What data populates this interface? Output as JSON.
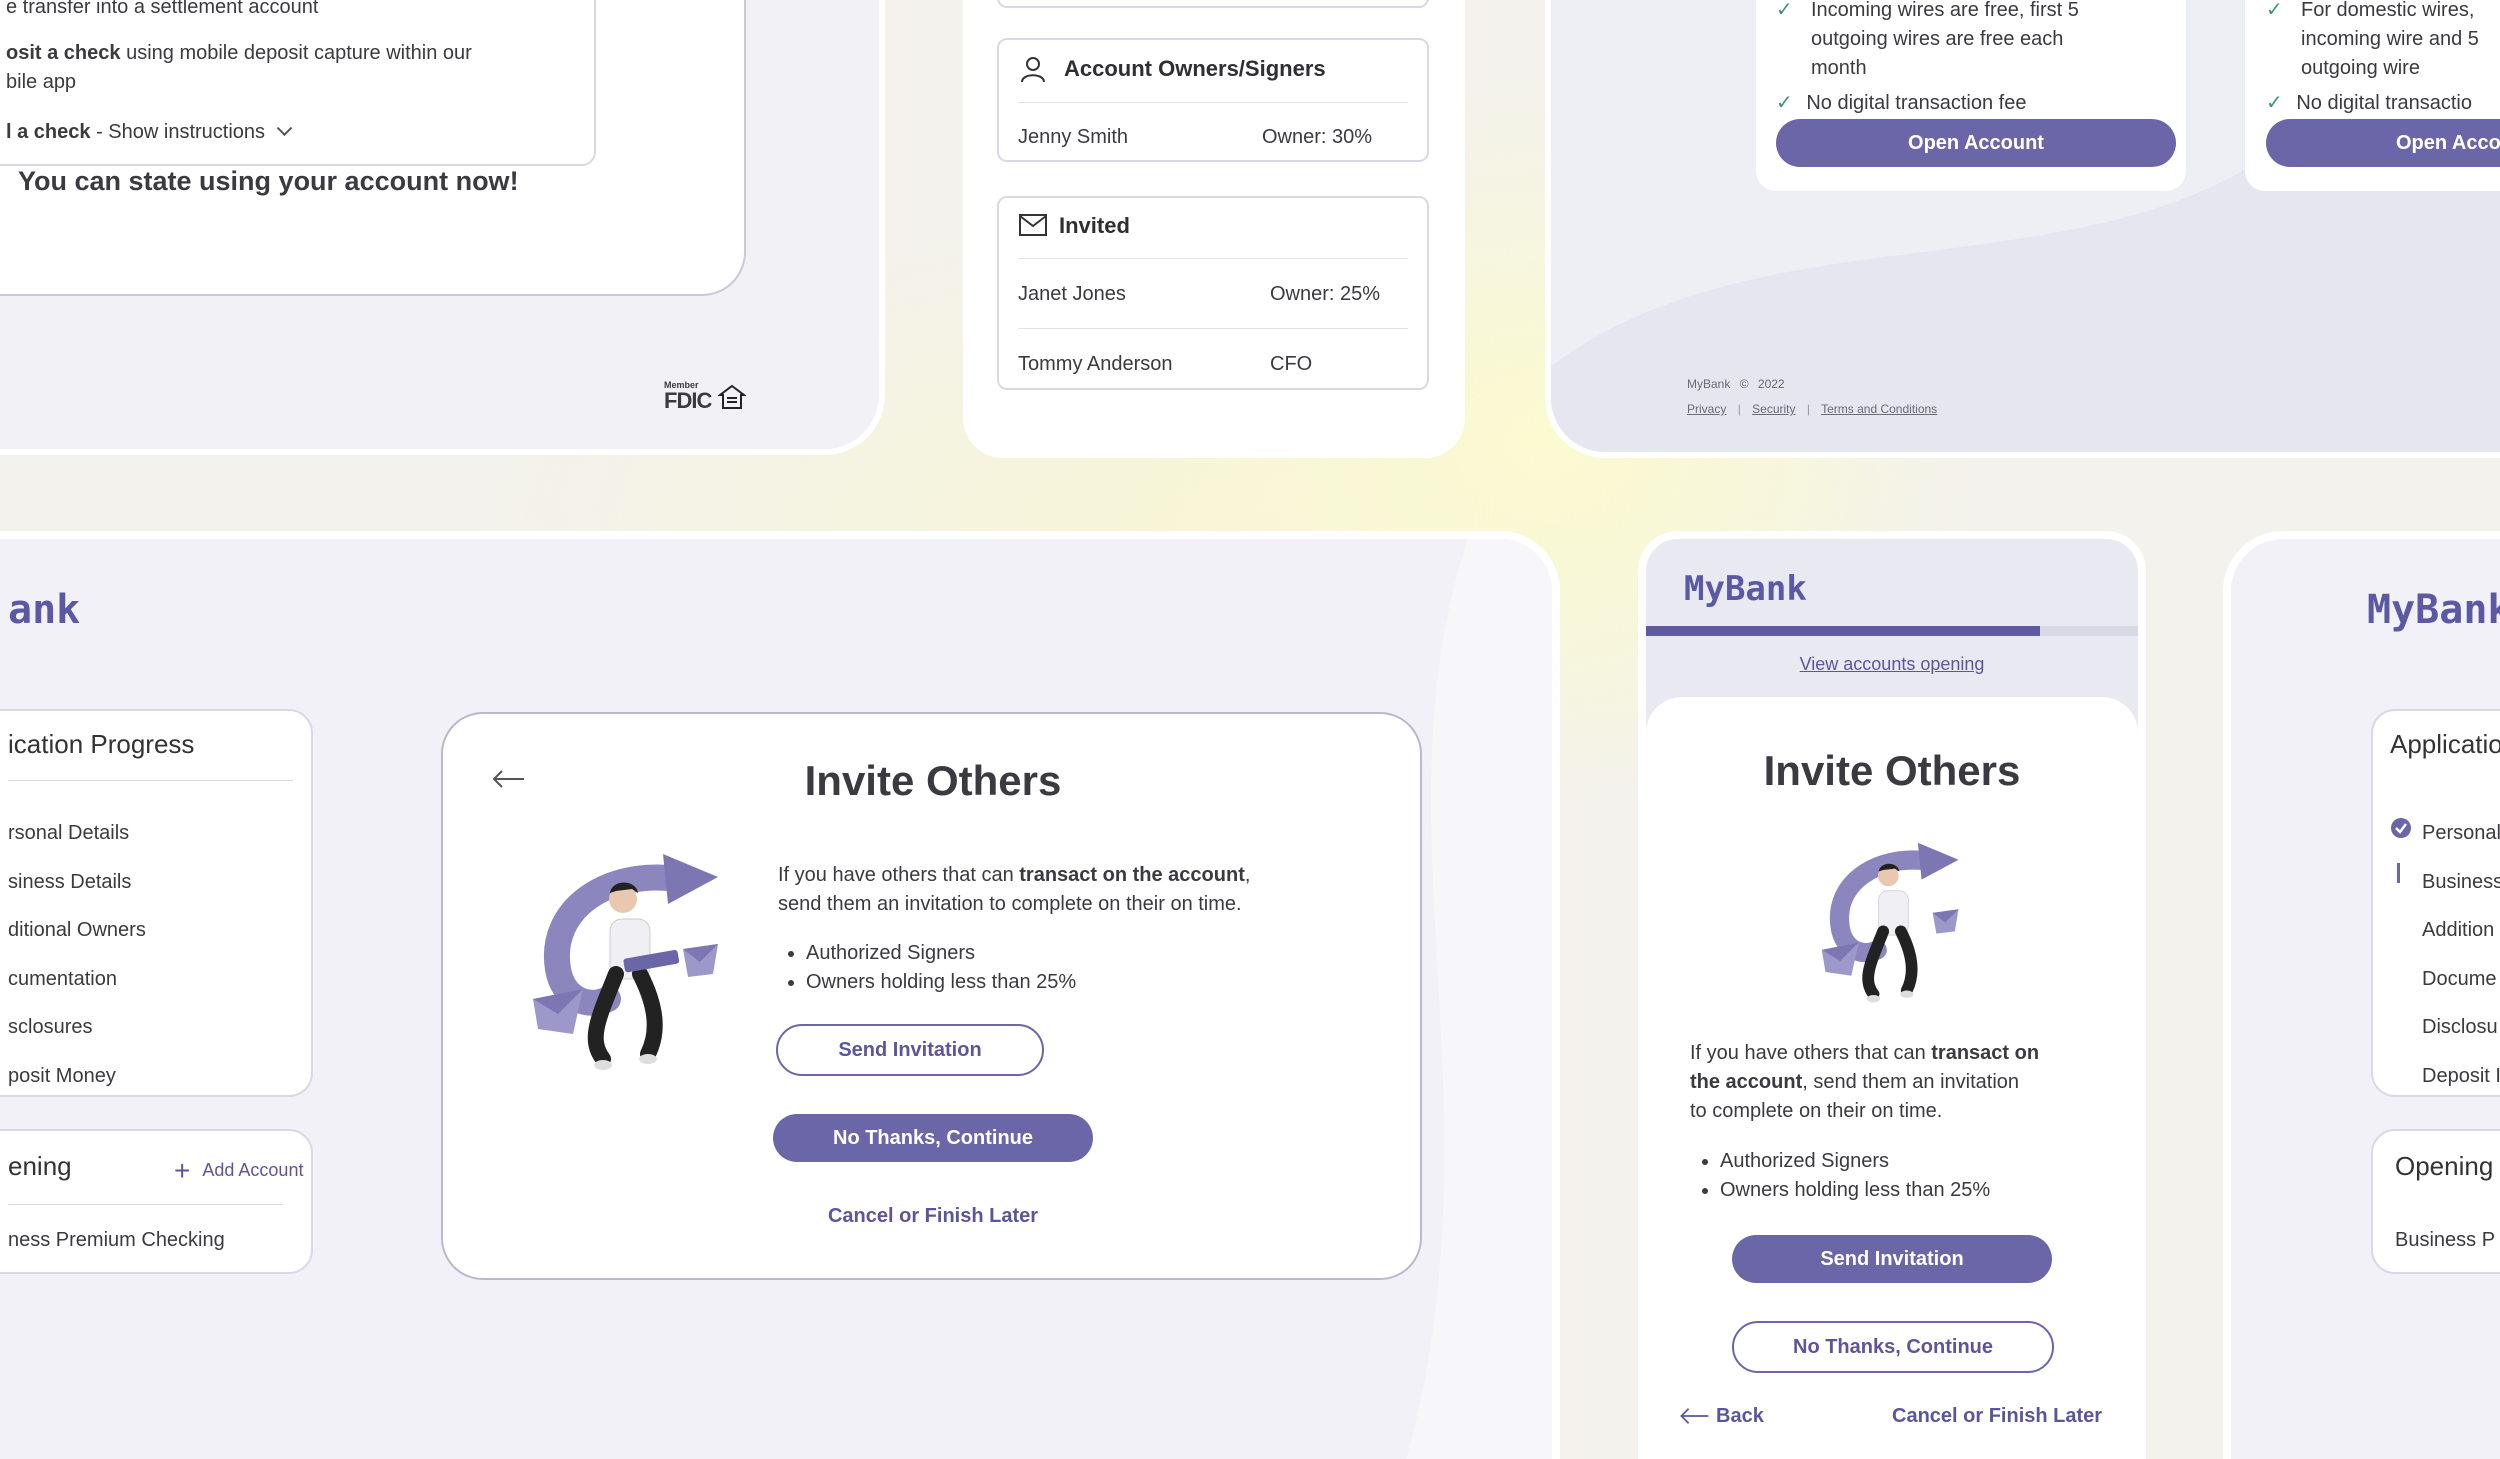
{
  "top_left": {
    "line1": "e transfer into a settlement account",
    "deposit_bold": "osit a check",
    "deposit_rest": " using mobile deposit capture within our",
    "deposit_line2": "bile app",
    "mail_bold": "l a check",
    "mail_rest": " - Show instructions",
    "state_now": "You can state using your account now!",
    "fdic_member": "Member",
    "fdic": "FDIC"
  },
  "top_middle": {
    "owners_title": "Account Owners/Signers",
    "owners": [
      {
        "name": "Jenny Smith",
        "role": "Owner: 30%"
      }
    ],
    "invited_title": "Invited",
    "invited": [
      {
        "name": "Janet Jones",
        "role": "Owner: 25%"
      },
      {
        "name": "Tommy Anderson",
        "role": "CFO"
      }
    ]
  },
  "top_right": {
    "card1": {
      "features": [
        "Incoming wires are free, first 5",
        "outgoing wires are free each",
        "month"
      ],
      "feature2": "No digital transaction fee",
      "button": "Open Account"
    },
    "card2": {
      "features": [
        "For domestic wires,",
        "incoming wire and 5",
        "outgoing wire"
      ],
      "feature2": "No digital transactio",
      "button": "Open Accou"
    },
    "footer": {
      "brand": "MyBank",
      "copyright": "©",
      "year": "2022",
      "links": [
        "Privacy",
        "Security",
        "Terms and Conditions"
      ]
    }
  },
  "bottom_left": {
    "brand": "ank",
    "progress_title": "ication Progress",
    "progress_items": [
      "rsonal Details",
      "siness Details",
      "ditional Owners",
      "cumentation",
      "sclosures",
      "posit Money"
    ],
    "opening_title": "ening",
    "add_account": "Add Account",
    "opening_item": "ness Premium Checking",
    "dialog": {
      "title": "Invite Others",
      "intro_pre": "If you have others that can ",
      "intro_bold": "transact on the account",
      "intro_post": ",",
      "intro_line2": "send them an invitation to complete on their on time.",
      "bullets": [
        "Authorized Signers",
        "Owners holding less than 25%"
      ],
      "send_button": "Send Invitation",
      "continue_button": "No Thanks, Continue",
      "cancel_link": "Cancel or Finish Later"
    }
  },
  "mobile": {
    "brand": "MyBank",
    "progress": 0.8,
    "view_link": "View accounts opening",
    "title": "Invite Others",
    "intro_pre": "If you have others that can ",
    "intro_bold": "transact on",
    "intro_bold2": "the account",
    "intro_rest": ", send them an invitation",
    "intro_line3": "to complete on their on time.",
    "bullets": [
      "Authorized Signers",
      "Owners holding less than 25%"
    ],
    "send_button": "Send Invitation",
    "continue_button": "No Thanks, Continue",
    "back": "Back",
    "cancel_link": "Cancel or Finish Later"
  },
  "bottom_right": {
    "brand": "MyBank",
    "progress_title": "Applicatio",
    "items": [
      "Personal",
      "Business",
      "Addition",
      "Docume",
      "Disclosu",
      "Deposit I"
    ],
    "opening_title": "Opening",
    "opening_item": "Business P"
  },
  "colors": {
    "accent": "#6b66a8",
    "check": "#3a9a6a",
    "panel": "#f3f3f8"
  }
}
